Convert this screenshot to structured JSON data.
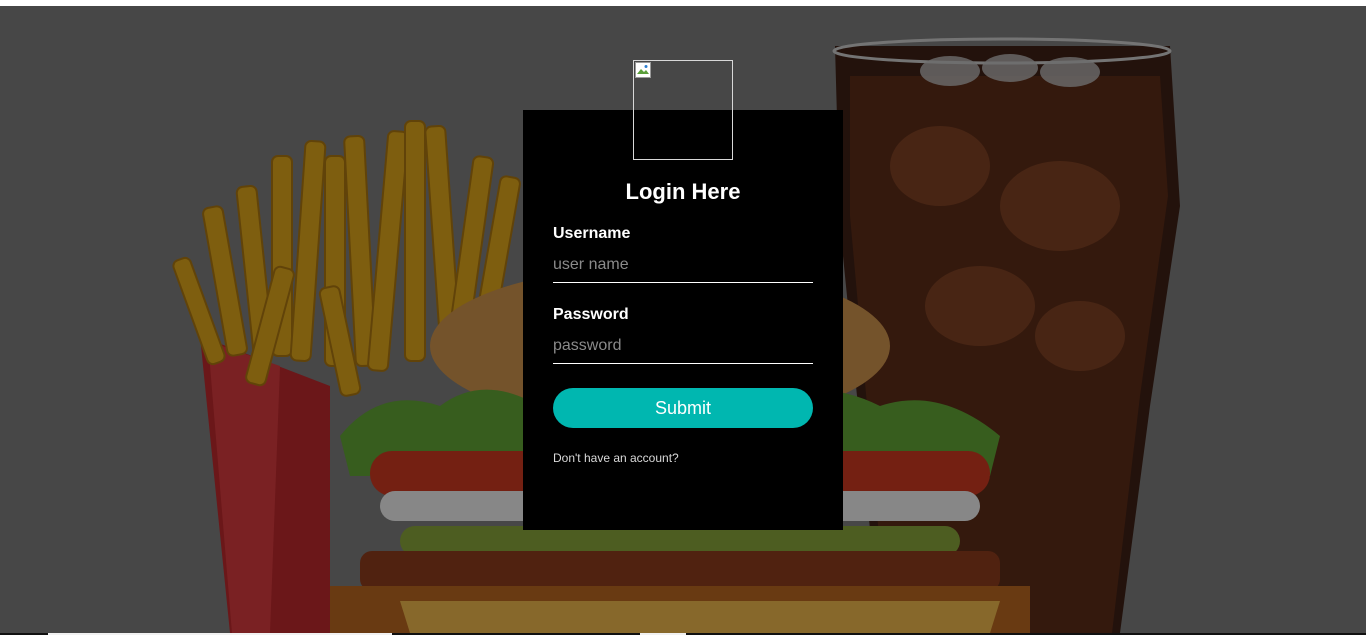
{
  "login": {
    "title": "Login Here",
    "username_label": "Username",
    "username_placeholder": "user name",
    "password_label": "Password",
    "password_placeholder": "password",
    "submit_label": "Submit",
    "signup_link": "Don't have an account?"
  },
  "colors": {
    "box_background": "#000000",
    "button": "#00b7b0",
    "overlay": "rgba(0,0,0,0.42)"
  },
  "background": {
    "description_icon": "fast-food-background"
  }
}
